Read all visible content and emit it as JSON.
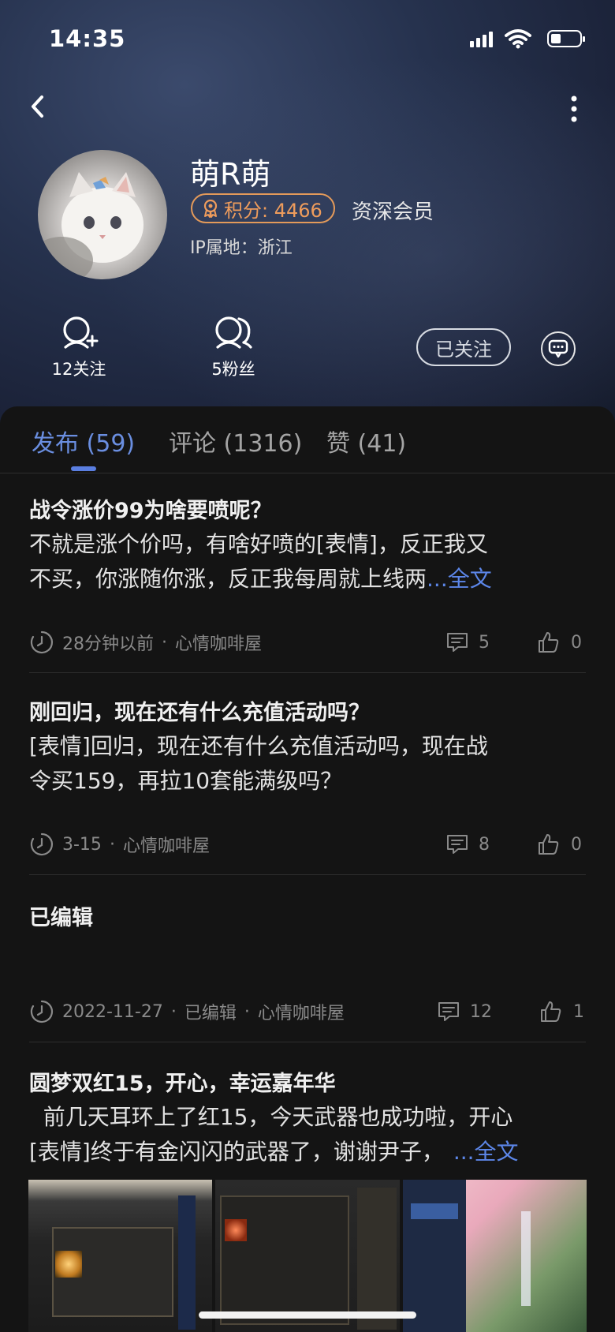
{
  "status_bar": {
    "time": "14:35"
  },
  "profile": {
    "username": "萌R萌",
    "points_label": "积分: 4466",
    "level": "资深会员",
    "ip_location": "IP属地：浙江",
    "following_label": "12关注",
    "followers_label": "5粉丝",
    "follow_button": "已关注"
  },
  "tabs": [
    {
      "label": "发布 (59)"
    },
    {
      "label": "评论 (1316)"
    },
    {
      "label": "赞 (41)"
    }
  ],
  "posts": [
    {
      "title": "战令涨价99为啥要喷呢？",
      "body_line1": "不就是涨个价吗，有啥好喷的[表情]，反正我又",
      "body_line2": "不买，你涨随你涨，反正我每周就上线两",
      "more": "...全文",
      "time": "28分钟以前",
      "dot": "·",
      "board": "心情咖啡屋",
      "comments": "5",
      "likes": "0"
    },
    {
      "title": "刚回归，现在还有什么充值活动吗？",
      "body_line1": "[表情]回归，现在还有什么充值活动吗，现在战",
      "body_line2": "令买159，再拉10套能满级吗？",
      "time": "3-15",
      "dot": "·",
      "board": "心情咖啡屋",
      "comments": "8",
      "likes": "0"
    },
    {
      "title": "已编辑",
      "time": "2022-11-27",
      "dot": "·",
      "edited": "已编辑",
      "dot2": "·",
      "board": "心情咖啡屋",
      "comments": "12",
      "likes": "1"
    },
    {
      "title": "圆梦双红15，开心，幸运嘉年华",
      "body_line1": "  前几天耳环上了红15，今天武器也成功啦，开心",
      "body_line2": "[表情]终于有金闪闪的武器了，谢谢尹子，",
      "more": "...全文"
    }
  ]
}
